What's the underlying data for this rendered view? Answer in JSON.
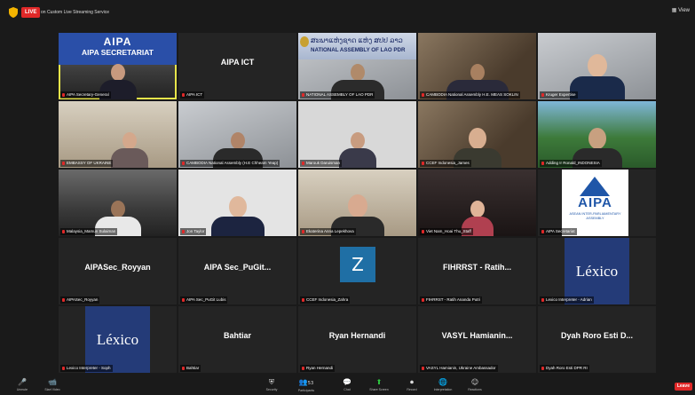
{
  "topbar": {
    "live_label": "LIVE",
    "stream_label": "on Custom Live Streaming Service",
    "view_label": "View"
  },
  "tiles": [
    {
      "name": "AIPA Secretary-General",
      "banner_title": "AIPA",
      "banner_sub": "AIPA SECRETARIAT"
    },
    {
      "name": "AIPA ICT",
      "display": "AIPA ICT"
    },
    {
      "name": "NATIONAL ASSEMBLY OF LAO PDR",
      "banner_lao": "ສະພາແຫ່ງຊາດ ແຫ່ງ ສປປ ລາວ",
      "banner_en": "NATIONAL ASSEMBLY OF LAO PDR"
    },
    {
      "name": "CAMBODIA National Assembly H.E. MEAS SOKLIN"
    },
    {
      "name": "Kruger Expertise"
    },
    {
      "name": "EMBASSY OF UKRAINE"
    },
    {
      "name": "CAMBODIA National Assembly (H.E Chheam Yeap)"
    },
    {
      "name": "Marouk Daruisman"
    },
    {
      "name": "CCEF Indonesia_James"
    },
    {
      "name": "Adding Ir Ronald_INDONESIA"
    },
    {
      "name": "Malaysia_Mamun Sulaiman"
    },
    {
      "name": "Jon Taylor"
    },
    {
      "name": "Ekaterina Anna Lepekhova"
    },
    {
      "name": "Viet Nam_Hoai Thu_Staff"
    },
    {
      "name": "AIPA Secretariat",
      "logo_word": "AIPA",
      "logo_sub": "ASEAN INTER-PARLIAMENTARY ASSEMBLY"
    },
    {
      "name": "AIPASec_Royyan",
      "display": "AIPASec_Royyan"
    },
    {
      "name": "AIPA Sec_PuGit Lubis",
      "display": "AIPA Sec_PuGit..."
    },
    {
      "name": "CCEF Indonesia_Zahra",
      "letter": "Z"
    },
    {
      "name": "FIHRRST - Ratih Ananda Putri",
      "display": "FIHRRST - Ratih..."
    },
    {
      "name": "Lexico Interpreter - Adrian",
      "logo": "Léxico"
    },
    {
      "name": "Lexico Interpreter - Soph",
      "logo": "Léxico"
    },
    {
      "name": "Bahtiar",
      "display": "Bahtiar"
    },
    {
      "name": "Ryan Hernandi",
      "display": "Ryan Hernandi"
    },
    {
      "name": "VASYL Hamianin, Ukraine Ambassador",
      "display": "VASYL Hamianin..."
    },
    {
      "name": "Dyah Roro Esti DPR RI",
      "display": "Dyah Roro Esti D..."
    }
  ],
  "toolbar": {
    "items": [
      {
        "label": "Unmute",
        "icon": "microphone-icon",
        "glyph": "🎤"
      },
      {
        "label": "Start Video",
        "icon": "video-icon",
        "glyph": "📹"
      },
      {
        "label": "Security",
        "icon": "shield-icon",
        "glyph": "⛨"
      },
      {
        "label": "Participants",
        "icon": "participants-icon",
        "glyph": "👥",
        "count": "53"
      },
      {
        "label": "Chat",
        "icon": "chat-icon",
        "glyph": "💬"
      },
      {
        "label": "Share Screen",
        "icon": "share-screen-icon",
        "glyph": "⬆"
      },
      {
        "label": "Record",
        "icon": "record-icon",
        "glyph": "⏺"
      },
      {
        "label": "Interpretation",
        "icon": "globe-icon",
        "glyph": "🌐"
      },
      {
        "label": "Reactions",
        "icon": "reactions-icon",
        "glyph": "☺"
      }
    ],
    "leave_label": "Leave"
  }
}
